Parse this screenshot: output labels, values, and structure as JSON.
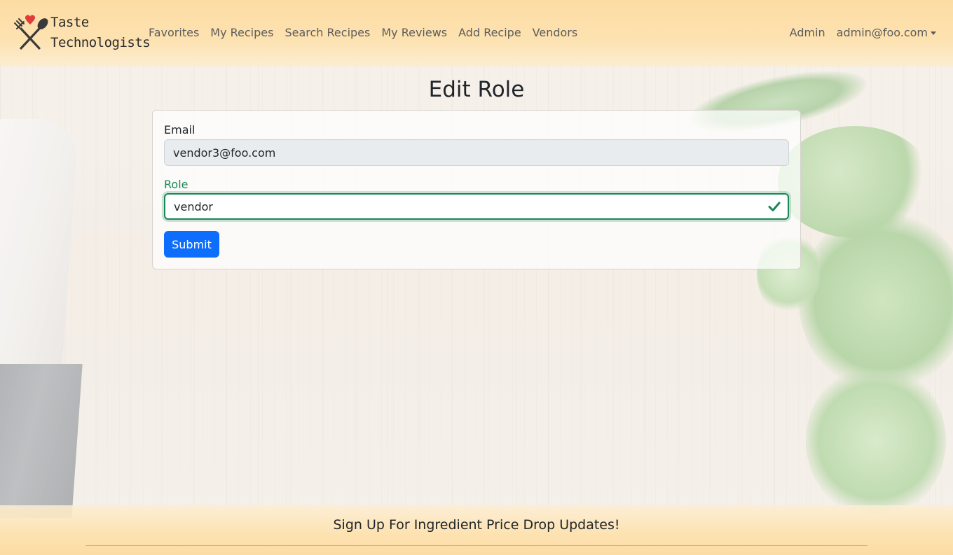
{
  "brand": {
    "line1": "Taste",
    "line2": "Technologists",
    "icon": "fork-spoon-heart-icon"
  },
  "nav": {
    "links": [
      "Favorites",
      "My Recipes",
      "Search Recipes",
      "My Reviews",
      "Add Recipe",
      "Vendors"
    ],
    "admin_label": "Admin",
    "user_menu_label": "admin@foo.com"
  },
  "page": {
    "title": "Edit Role"
  },
  "form": {
    "email_label": "Email",
    "email_value": "vendor3@foo.com",
    "role_label": "Role",
    "role_value": "vendor",
    "submit_label": "Submit"
  },
  "footer": {
    "title": "Sign Up For Ingredient Price Drop Updates!"
  },
  "colors": {
    "primary": "#0d6efd",
    "valid": "#198754",
    "navbar": "#fddca3"
  }
}
